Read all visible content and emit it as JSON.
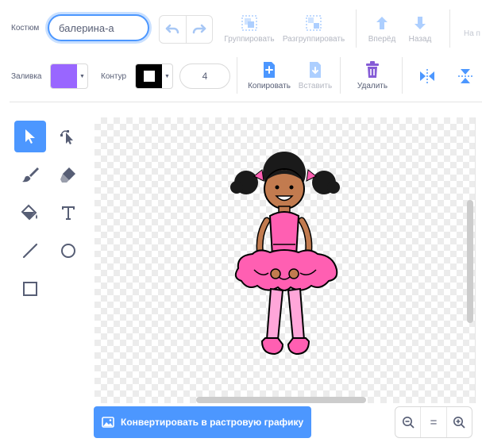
{
  "header": {
    "costume_label": "Костюм",
    "costume_name": "балерина-а"
  },
  "toolbar": {
    "group": "Группировать",
    "ungroup": "Разгруппировать",
    "forward": "Вперёд",
    "backward": "Назад",
    "front_partial": "На п"
  },
  "style": {
    "fill_label": "Заливка",
    "fill_color": "#9966ff",
    "outline_label": "Контур",
    "outline_color": "#000000",
    "outline_width": "4"
  },
  "actions": {
    "copy": "Копировать",
    "paste": "Вставить",
    "delete": "Удалить"
  },
  "tools": [
    "select",
    "reshape",
    "brush",
    "eraser",
    "fill",
    "text",
    "line",
    "circle",
    "rectangle"
  ],
  "footer": {
    "convert_button": "Конвертировать в растровую графику",
    "zoom_reset": "="
  },
  "colors": {
    "accent": "#4c97ff",
    "delete": "#855cd6"
  }
}
